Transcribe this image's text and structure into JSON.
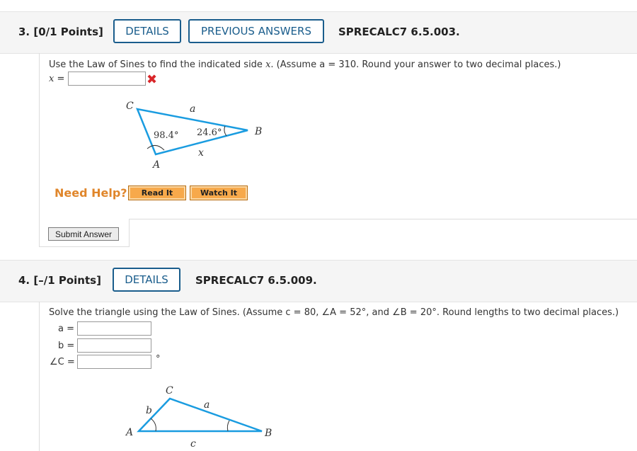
{
  "q3": {
    "number": "3.",
    "points": "[0/1 Points]",
    "details_label": "DETAILS",
    "prev_answers_label": "PREVIOUS ANSWERS",
    "code": "SPRECALC7 6.5.003.",
    "prompt_pre": "Use the Law of Sines to find the indicated side ",
    "prompt_var": "x",
    "prompt_post": ". (Assume a = 310. Round your answer to two decimal places.)",
    "x_label": "x =",
    "x_value": "",
    "status": "✖",
    "diagram": {
      "C": "C",
      "A": "A",
      "B": "B",
      "a": "a",
      "x": "x",
      "angle_A": "98.4°",
      "angle_B": "24.6°"
    },
    "need_help": "Need Help?",
    "read_it": "Read It",
    "watch_it": "Watch It",
    "submit": "Submit Answer"
  },
  "q4": {
    "number": "4.",
    "points": "[–/1 Points]",
    "details_label": "DETAILS",
    "code": "SPRECALC7 6.5.009.",
    "prompt": "Solve the triangle using the Law of Sines. (Assume c = 80, ∠A = 52°, and ∠B = 20°. Round lengths to two decimal places.)",
    "a_label": "a =",
    "b_label": "b =",
    "C_label": "∠C =",
    "a_value": "",
    "b_value": "",
    "C_value": "",
    "degree": "°",
    "diagram": {
      "A": "A",
      "B": "B",
      "C": "C",
      "a": "a",
      "b": "b",
      "c": "c"
    }
  },
  "colors": {
    "accent": "#1a5d8c",
    "triangle": "#1a9ce0",
    "help": "#e0862b",
    "error": "#d9262a"
  }
}
